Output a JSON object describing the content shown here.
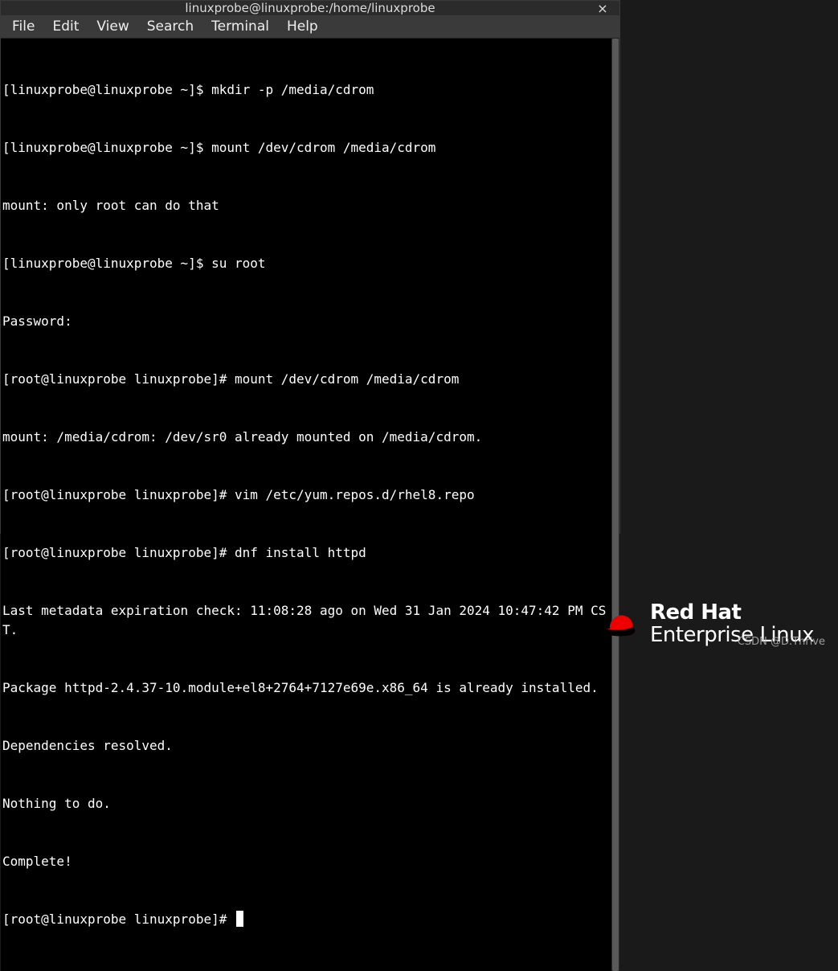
{
  "window": {
    "title": "linuxprobe@linuxprobe:/home/linuxprobe",
    "close_glyph": "×"
  },
  "menubar": {
    "items": [
      "File",
      "Edit",
      "View",
      "Search",
      "Terminal",
      "Help"
    ]
  },
  "terminal": {
    "lines": [
      "[linuxprobe@linuxprobe ~]$ mkdir -p /media/cdrom",
      "[linuxprobe@linuxprobe ~]$ mount /dev/cdrom /media/cdrom",
      "mount: only root can do that",
      "[linuxprobe@linuxprobe ~]$ su root",
      "Password:",
      "[root@linuxprobe linuxprobe]# mount /dev/cdrom /media/cdrom",
      "mount: /media/cdrom: /dev/sr0 already mounted on /media/cdrom.",
      "[root@linuxprobe linuxprobe]# vim /etc/yum.repos.d/rhel8.repo",
      "[root@linuxprobe linuxprobe]# dnf install httpd",
      "Last metadata expiration check: 11:08:28 ago on Wed 31 Jan 2024 10:47:42 PM CST.",
      "Package httpd-2.4.37-10.module+el8+2764+7127e69e.x86_64 is already installed.",
      "Dependencies resolved.",
      "Nothing to do.",
      "Complete!",
      "[root@linuxprobe linuxprobe]# "
    ]
  },
  "branding": {
    "redhat": "Red Hat",
    "enterprise_linux": "Enterprise Linux",
    "hat_color": "#ee0000"
  },
  "watermark": "CSDN @D.Thrive"
}
